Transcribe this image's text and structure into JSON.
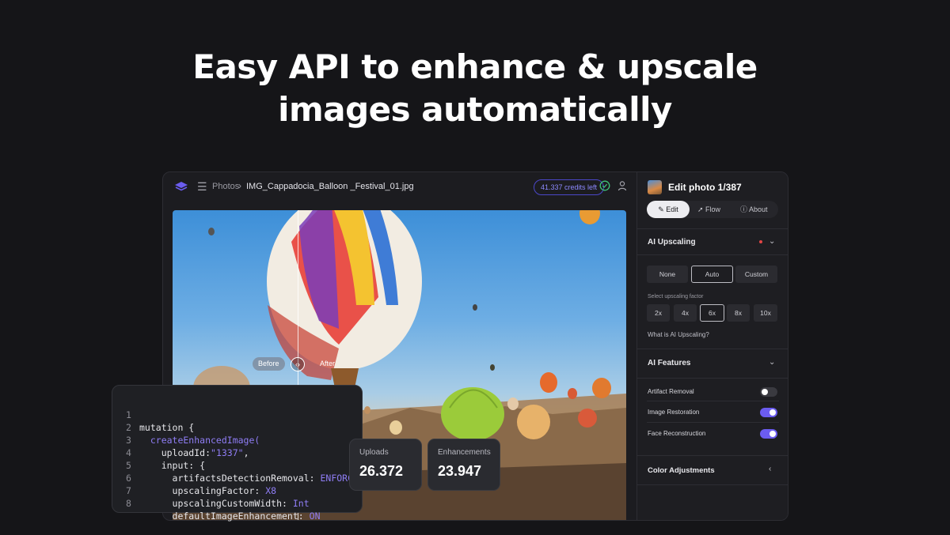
{
  "headline": {
    "line1": "Easy API to enhance & upscale",
    "line2": "images automatically"
  },
  "topbar": {
    "breadcrumb": "Photos",
    "separator": "›",
    "filename": "IMG_Cappadocia_Balloon _Festival_01.jpg",
    "credits": "41.337 credits left"
  },
  "photo": {
    "before_label": "Before",
    "after_label": "After",
    "split_position": 0.275
  },
  "panel": {
    "title": "Edit photo 1/387",
    "tabs": [
      {
        "label": "Edit",
        "active": true
      },
      {
        "label": "Flow",
        "active": false
      },
      {
        "label": "About",
        "active": false
      }
    ],
    "ai_upscaling": {
      "title": "AI Upscaling",
      "modes": [
        {
          "label": "None",
          "active": false
        },
        {
          "label": "Auto",
          "active": true
        },
        {
          "label": "Custom",
          "active": false
        }
      ],
      "factor_label": "Select upscaling factor",
      "factors": [
        {
          "label": "2x",
          "active": false
        },
        {
          "label": "4x",
          "active": false
        },
        {
          "label": "6x",
          "active": true
        },
        {
          "label": "8x",
          "active": false
        },
        {
          "label": "10x",
          "active": false
        }
      ],
      "help_link": "What is AI Upscaling?"
    },
    "ai_features": {
      "title": "AI Features",
      "items": [
        {
          "label": "Artifact Removal",
          "enabled": false
        },
        {
          "label": "Image Restoration",
          "enabled": true
        },
        {
          "label": "Face Reconstruction",
          "enabled": true
        }
      ]
    },
    "color_adjustments": {
      "title": "Color Adjustments"
    }
  },
  "code": {
    "lines": [
      {
        "n": "1",
        "text": "mutation {"
      },
      {
        "n": "2",
        "text": "  createEnhancedImage("
      },
      {
        "n": "3",
        "text": "    uploadId:",
        "value": "\"1337\"",
        "tail": ","
      },
      {
        "n": "4",
        "text": "    input: {"
      },
      {
        "n": "5",
        "text": "      artifactsDetectionRemoval: ",
        "value": "ENFORCE"
      },
      {
        "n": "6",
        "text": "      upscalingFactor: ",
        "value": "X8"
      },
      {
        "n": "7",
        "text": "      upscalingCustomWidth: ",
        "value": "Int"
      },
      {
        "n": "8",
        "text": "      defaultImageEnhancement: ",
        "value": "ON"
      }
    ]
  },
  "stats": {
    "uploads_label": "Uploads",
    "uploads_value": "26.372",
    "enhancements_label": "Enhancements",
    "enhancements_value": "23.947"
  },
  "colors": {
    "accent": "#6b5cf0",
    "background": "#151518",
    "panel": "#1e1e22"
  }
}
